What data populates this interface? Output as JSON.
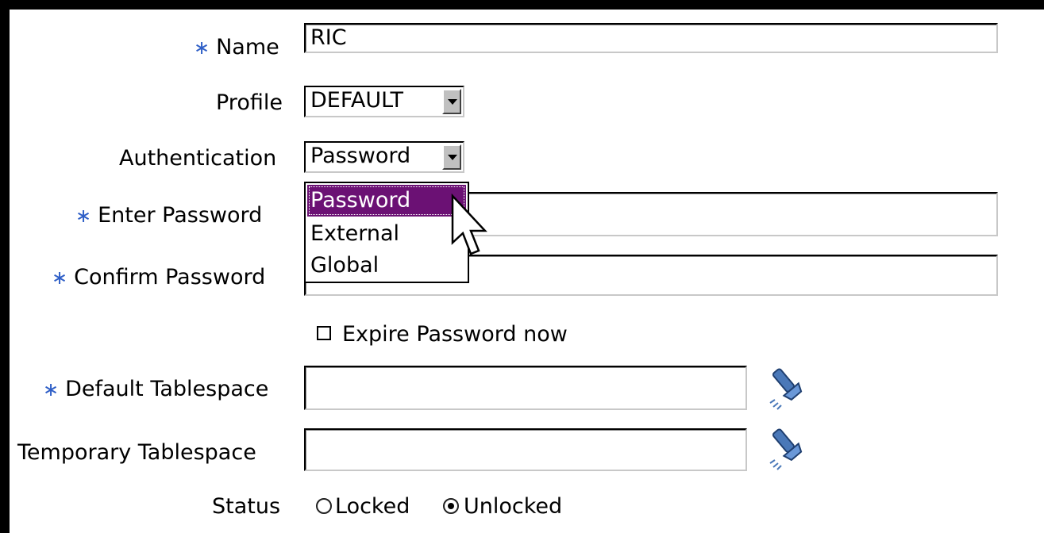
{
  "form": {
    "name": {
      "label": "Name",
      "required_marker": "∗",
      "value": "RIC"
    },
    "profile": {
      "label": "Profile",
      "selected": "DEFAULT"
    },
    "authentication": {
      "label": "Authentication",
      "selected": "Password",
      "options": [
        "Password",
        "External",
        "Global"
      ],
      "highlighted_option": "Password"
    },
    "enter_password": {
      "label": "Enter Password",
      "required_marker": "∗",
      "value": ""
    },
    "confirm_password": {
      "label": "Confirm Password",
      "required_marker": "∗",
      "value": ""
    },
    "expire_password": {
      "label": "Expire Password now",
      "checked": false
    },
    "default_tablespace": {
      "label": "Default Tablespace",
      "required_marker": "∗",
      "value": "",
      "search_icon": "flashlight-icon"
    },
    "temporary_tablespace": {
      "label": "Temporary Tablespace",
      "value": "",
      "search_icon": "flashlight-icon"
    },
    "status": {
      "label": "Status",
      "options": [
        "Locked",
        "Unlocked"
      ],
      "selected": "Unlocked"
    }
  },
  "colors": {
    "required_marker": "#2f5fc7",
    "highlight": "#6b1174",
    "flashlight": "#4a78b8"
  }
}
